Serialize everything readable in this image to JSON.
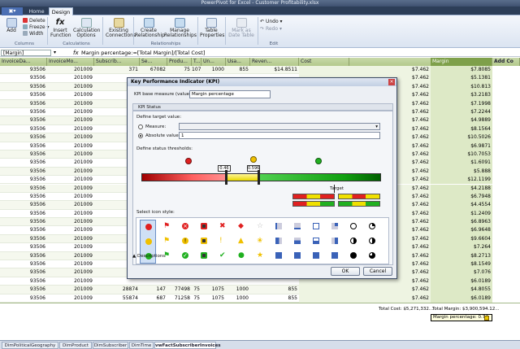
{
  "window": {
    "title": "PowerPivot for Excel - Customer Profitability.xlsx"
  },
  "tabs": {
    "file": "",
    "home": "Home",
    "design": "Design"
  },
  "ribbon": {
    "add": "Add",
    "delete": "Delete",
    "freeze": "Freeze",
    "width": "Width",
    "group_columns": "Columns",
    "insert_function": "Insert Function",
    "calc_options": "Calculation Options",
    "group_calculations": "Calculations",
    "existing_connections": "Existing Connections",
    "create_relationship": "Create Relationship",
    "manage_relationships": "Manage Relationships",
    "group_relationships": "Relationships",
    "table_properties": "Table Properties",
    "mark_as_date_table": "Mark as Date Table",
    "undo": "Undo",
    "redo": "Redo",
    "group_edit": "Edit"
  },
  "formula_bar": {
    "name_box": "[Margin]",
    "fx": "fx",
    "formula": "Margin percentage:=[Total Margin]/[Total Cost]"
  },
  "grid": {
    "headers": [
      "InvoiceDa...",
      "InvoiceMo...",
      "Subscrib...",
      "Se...",
      "Produ...",
      "T...",
      "Un...",
      "Usa...",
      "Reven...",
      "Cost",
      "Margin",
      "Add Co"
    ],
    "rows": [
      [
        "93506",
        "201009",
        "371",
        "67082",
        "75",
        "1075",
        "1000",
        "855",
        "$14.8511",
        "$7.462",
        "$7.8085"
      ],
      [
        "93506",
        "201009",
        "",
        "",
        "",
        "",
        "",
        "",
        "",
        "$7.462",
        "$5.1381"
      ],
      [
        "93506",
        "201009",
        "",
        "",
        "",
        "",
        "",
        "",
        "",
        "$7.462",
        "$10.813"
      ],
      [
        "93506",
        "201009",
        "",
        "",
        "",
        "",
        "",
        "",
        "",
        "$7.462",
        "$3.2183"
      ],
      [
        "93506",
        "201009",
        "",
        "",
        "",
        "",
        "",
        "",
        "",
        "$7.462",
        "$7.1998"
      ],
      [
        "93506",
        "201009",
        "",
        "",
        "",
        "",
        "",
        "",
        "",
        "$7.462",
        "$7.2244"
      ],
      [
        "93506",
        "201009",
        "",
        "",
        "",
        "",
        "",
        "",
        "",
        "$7.462",
        "$4.9889"
      ],
      [
        "93506",
        "201009",
        "",
        "",
        "",
        "",
        "",
        "",
        "",
        "$7.462",
        "$8.1564"
      ],
      [
        "93506",
        "201009",
        "",
        "",
        "",
        "",
        "",
        "",
        "",
        "$7.462",
        "$10.5026"
      ],
      [
        "93506",
        "201009",
        "",
        "",
        "",
        "",
        "",
        "",
        "",
        "$7.462",
        "$6.9871"
      ],
      [
        "93506",
        "201009",
        "",
        "",
        "",
        "",
        "",
        "",
        "",
        "$7.462",
        "$10.7053"
      ],
      [
        "93506",
        "201009",
        "",
        "",
        "",
        "",
        "",
        "",
        "",
        "$7.462",
        "$1.6091"
      ],
      [
        "93506",
        "201009",
        "",
        "",
        "",
        "",
        "",
        "",
        "",
        "$7.462",
        "$5.888"
      ],
      [
        "93506",
        "201009",
        "",
        "",
        "",
        "",
        "",
        "",
        "",
        "$7.462",
        "$12.1199"
      ],
      [
        "93506",
        "201009",
        "",
        "",
        "",
        "",
        "",
        "",
        "",
        "$7.462",
        "$4.2188"
      ],
      [
        "93506",
        "201009",
        "",
        "",
        "",
        "",
        "",
        "",
        "",
        "$7.462",
        "$6.7948"
      ],
      [
        "93506",
        "201009",
        "",
        "",
        "",
        "",
        "",
        "",
        "",
        "$7.462",
        "$4.4554"
      ],
      [
        "93506",
        "201009",
        "",
        "",
        "",
        "",
        "",
        "",
        "",
        "$7.462",
        "$1.2409"
      ],
      [
        "93506",
        "201009",
        "",
        "",
        "",
        "",
        "",
        "",
        "",
        "$7.462",
        "$6.8963"
      ],
      [
        "93506",
        "201009",
        "",
        "",
        "",
        "",
        "",
        "",
        "",
        "$7.462",
        "$6.9648"
      ],
      [
        "93506",
        "201009",
        "",
        "",
        "",
        "",
        "",
        "",
        "",
        "$7.462",
        "$9.6604"
      ],
      [
        "93506",
        "201009",
        "",
        "",
        "",
        "",
        "",
        "",
        "",
        "$7.462",
        "$7.264"
      ],
      [
        "93506",
        "201009",
        "",
        "",
        "",
        "",
        "",
        "",
        "",
        "$7.462",
        "$8.2713"
      ],
      [
        "93506",
        "201009",
        "",
        "",
        "",
        "",
        "",
        "",
        "",
        "$7.462",
        "$8.1549"
      ],
      [
        "93506",
        "201009",
        "",
        "",
        "",
        "",
        "",
        "",
        "",
        "$7.462",
        "$7.076"
      ],
      [
        "93506",
        "201009",
        "",
        "",
        "",
        "",
        "",
        "",
        "",
        "$7.462",
        "$6.0189"
      ],
      [
        "93506",
        "201009",
        "28874",
        "147",
        "77498",
        "75",
        "1075",
        "1000",
        "855",
        "$14.8511",
        "$7.462",
        "$4.8055"
      ],
      [
        "93506",
        "201009",
        "55874",
        "687",
        "71258",
        "75",
        "1075",
        "1000",
        "855",
        "$7.462",
        "$7.462",
        "$6.0189"
      ]
    ]
  },
  "totals": {
    "total_cost": "Total Cost: $5,271,332...",
    "total_margin": "Total Margin: $3,900,594.12...",
    "margin_pct": "Margin percentage: 0.74"
  },
  "sheets": [
    "DimPoliticalGeography",
    "DimProduct",
    "DimSubscriber",
    "DimTime",
    "vwFactSubscriberInvoices"
  ],
  "kpi_dialog": {
    "title": "Key Performance Indicator (KPI)",
    "base_measure_label": "KPI base measure (value):",
    "base_measure_value": "Margin percentage",
    "kpi_status": "KPI Status",
    "define_target": "Define target value:",
    "measure_label": "Measure:",
    "absolute_label": "Absolute value:",
    "absolute_value": "1",
    "thresholds_label": "Define status thresholds:",
    "threshold_low": "0.46",
    "threshold_high": "0.596",
    "target_label": "Target",
    "icon_style_label": "Select icon style:",
    "descriptions": "Descriptions",
    "ok": "OK",
    "cancel": "Cancel",
    "colors": {
      "red": "#e02020",
      "yellow": "#f0e000",
      "green": "#20b020"
    }
  }
}
